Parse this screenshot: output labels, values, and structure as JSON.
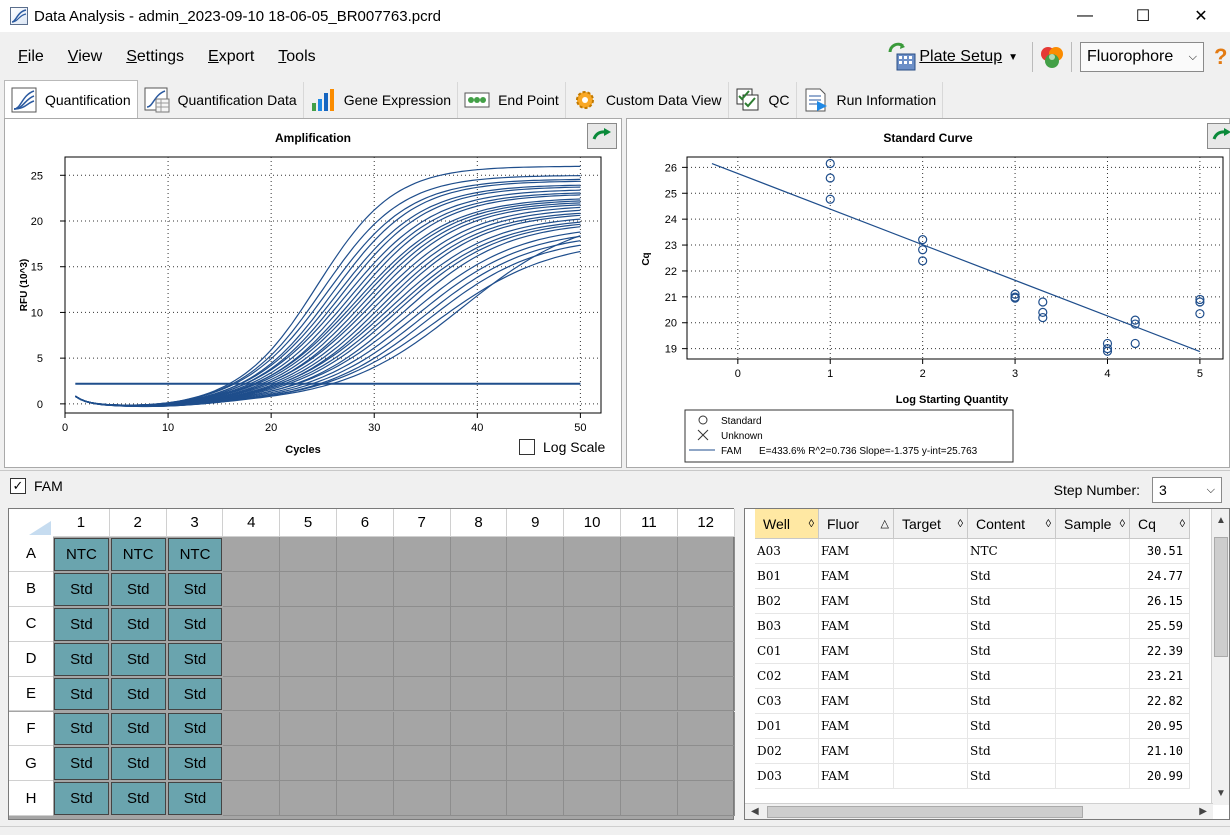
{
  "window": {
    "title": "Data Analysis - admin_2023-09-10 18-06-05_BR007763.pcrd",
    "minimize": "—",
    "maximize": "☐",
    "close": "✕"
  },
  "menu": {
    "items": [
      {
        "first": "F",
        "rest": "ile"
      },
      {
        "first": "V",
        "rest": "iew"
      },
      {
        "first": "S",
        "rest": "ettings"
      },
      {
        "first": "E",
        "rest": "xport"
      },
      {
        "first": "T",
        "rest": "ools"
      }
    ],
    "plate_setup": "Plate Setup",
    "fluorophore": "Fluorophore",
    "help": "?"
  },
  "tabs": [
    {
      "label": "Quantification",
      "icon": "amplification-icon",
      "active": true
    },
    {
      "label": "Quantification Data",
      "icon": "quant-data-icon"
    },
    {
      "label": "Gene Expression",
      "icon": "bar-chart-icon"
    },
    {
      "label": "End Point",
      "icon": "end-point-icon"
    },
    {
      "label": "Custom Data View",
      "icon": "gear-icon"
    },
    {
      "label": "QC",
      "icon": "qc-icon"
    },
    {
      "label": "Run Information",
      "icon": "run-info-icon"
    }
  ],
  "amplification": {
    "title": "Amplification",
    "xlabel": "Cycles",
    "ylabel": "RFU (10^3)",
    "log_scale_label": "Log Scale",
    "log_scale_checked": false
  },
  "standard_curve": {
    "title": "Standard Curve",
    "xlabel": "Log Starting Quantity",
    "ylabel": "Cq",
    "legend_standard": "Standard",
    "legend_unknown": "Unknown",
    "legend_fam": "FAM",
    "legend_stats": "E=433.6% R^2=0.736 Slope=-1.375 y-int=25.763"
  },
  "chart_data": [
    {
      "type": "line",
      "title": "Amplification",
      "xlabel": "Cycles",
      "ylabel": "RFU (10^3)",
      "xlim": [
        0,
        52
      ],
      "ylim": [
        -1,
        27
      ],
      "xticks": [
        0,
        10,
        20,
        30,
        40,
        50
      ],
      "yticks": [
        0,
        5,
        10,
        15,
        20,
        25
      ],
      "grid": true,
      "threshold": 2.2,
      "curve_model": {
        "baseline_min": -0.4,
        "curves": 27
      },
      "series": [
        {
          "midpoint": 24.5,
          "plateau": 26.0,
          "slope": 0.27
        },
        {
          "midpoint": 25.0,
          "plateau": 25.0,
          "slope": 0.26
        },
        {
          "midpoint": 25.5,
          "plateau": 24.6,
          "slope": 0.25
        },
        {
          "midpoint": 26.0,
          "plateau": 24.4,
          "slope": 0.25
        },
        {
          "midpoint": 26.4,
          "plateau": 24.0,
          "slope": 0.24
        },
        {
          "midpoint": 26.8,
          "plateau": 23.8,
          "slope": 0.24
        },
        {
          "midpoint": 27.2,
          "plateau": 23.5,
          "slope": 0.23
        },
        {
          "midpoint": 27.6,
          "plateau": 23.2,
          "slope": 0.23
        },
        {
          "midpoint": 28.0,
          "plateau": 23.0,
          "slope": 0.23
        },
        {
          "midpoint": 28.3,
          "plateau": 22.6,
          "slope": 0.22
        },
        {
          "midpoint": 28.6,
          "plateau": 22.4,
          "slope": 0.22
        },
        {
          "midpoint": 29.0,
          "plateau": 22.2,
          "slope": 0.22
        },
        {
          "midpoint": 29.4,
          "plateau": 22.0,
          "slope": 0.22
        },
        {
          "midpoint": 29.8,
          "plateau": 21.8,
          "slope": 0.21
        },
        {
          "midpoint": 30.2,
          "plateau": 21.5,
          "slope": 0.21
        },
        {
          "midpoint": 30.6,
          "plateau": 21.2,
          "slope": 0.21
        },
        {
          "midpoint": 31.0,
          "plateau": 21.0,
          "slope": 0.21
        },
        {
          "midpoint": 31.4,
          "plateau": 20.7,
          "slope": 0.2
        },
        {
          "midpoint": 31.8,
          "plateau": 20.4,
          "slope": 0.2
        },
        {
          "midpoint": 32.2,
          "plateau": 20.2,
          "slope": 0.2
        },
        {
          "midpoint": 32.8,
          "plateau": 20.0,
          "slope": 0.2
        },
        {
          "midpoint": 33.4,
          "plateau": 19.6,
          "slope": 0.19
        },
        {
          "midpoint": 34.0,
          "plateau": 19.2,
          "slope": 0.19
        },
        {
          "midpoint": 34.6,
          "plateau": 18.8,
          "slope": 0.19
        },
        {
          "midpoint": 35.2,
          "plateau": 18.4,
          "slope": 0.19
        },
        {
          "midpoint": 36.0,
          "plateau": 18.0,
          "slope": 0.18
        },
        {
          "midpoint": 38.5,
          "plateau": 21.0,
          "slope": 0.17
        }
      ]
    },
    {
      "type": "scatter",
      "title": "Standard Curve",
      "xlabel": "Log Starting Quantity",
      "ylabel": "Cq",
      "xlim": [
        -0.55,
        5.25
      ],
      "ylim": [
        18.6,
        26.4
      ],
      "xticks": [
        0,
        1,
        2,
        3,
        4,
        5
      ],
      "yticks": [
        19,
        20,
        21,
        22,
        23,
        24,
        25,
        26
      ],
      "grid": true,
      "points": [
        {
          "x": 1.0,
          "y": 26.15
        },
        {
          "x": 1.0,
          "y": 25.59
        },
        {
          "x": 1.0,
          "y": 24.77
        },
        {
          "x": 2.0,
          "y": 23.21
        },
        {
          "x": 2.0,
          "y": 22.82
        },
        {
          "x": 2.0,
          "y": 22.39
        },
        {
          "x": 3.0,
          "y": 21.1
        },
        {
          "x": 3.0,
          "y": 20.99
        },
        {
          "x": 3.0,
          "y": 20.95
        },
        {
          "x": 3.3,
          "y": 20.8
        },
        {
          "x": 3.3,
          "y": 20.4
        },
        {
          "x": 3.3,
          "y": 20.2
        },
        {
          "x": 4.0,
          "y": 19.2
        },
        {
          "x": 4.0,
          "y": 19.0
        },
        {
          "x": 4.0,
          "y": 18.9
        },
        {
          "x": 4.3,
          "y": 20.1
        },
        {
          "x": 4.3,
          "y": 19.95
        },
        {
          "x": 4.3,
          "y": 19.2
        },
        {
          "x": 5.0,
          "y": 20.9
        },
        {
          "x": 5.0,
          "y": 20.8
        },
        {
          "x": 5.0,
          "y": 20.35
        }
      ],
      "fit": {
        "slope": -1.375,
        "intercept": 25.763,
        "x_from": -0.28,
        "x_to": 5.0
      }
    }
  ],
  "fam": {
    "label": "FAM",
    "checked": true
  },
  "step": {
    "label": "Step Number:",
    "value": "3"
  },
  "plate": {
    "columns": [
      "1",
      "2",
      "3",
      "4",
      "5",
      "6",
      "7",
      "8",
      "9",
      "10",
      "11",
      "12"
    ],
    "rows": [
      "A",
      "B",
      "C",
      "D",
      "E",
      "F",
      "G",
      "H"
    ],
    "wells": [
      [
        "NTC",
        "NTC",
        "NTC"
      ],
      [
        "Std",
        "Std",
        "Std"
      ],
      [
        "Std",
        "Std",
        "Std"
      ],
      [
        "Std",
        "Std",
        "Std"
      ],
      [
        "Std",
        "Std",
        "Std"
      ],
      [
        "Std",
        "Std",
        "Std"
      ],
      [
        "Std",
        "Std",
        "Std"
      ],
      [
        "Std",
        "Std",
        "Std"
      ]
    ]
  },
  "table": {
    "headers": [
      {
        "label": "Well",
        "sort": "◊"
      },
      {
        "label": "Fluor",
        "sort": "△"
      },
      {
        "label": "Target",
        "sort": "◊"
      },
      {
        "label": "Content",
        "sort": "◊"
      },
      {
        "label": "Sample",
        "sort": "◊"
      },
      {
        "label": "Cq",
        "sort": "◊"
      }
    ],
    "rows": [
      [
        "A03",
        "FAM",
        "",
        "NTC",
        "",
        "30.51"
      ],
      [
        "B01",
        "FAM",
        "",
        "Std",
        "",
        "24.77"
      ],
      [
        "B02",
        "FAM",
        "",
        "Std",
        "",
        "26.15"
      ],
      [
        "B03",
        "FAM",
        "",
        "Std",
        "",
        "25.59"
      ],
      [
        "C01",
        "FAM",
        "",
        "Std",
        "",
        "22.39"
      ],
      [
        "C02",
        "FAM",
        "",
        "Std",
        "",
        "23.21"
      ],
      [
        "C03",
        "FAM",
        "",
        "Std",
        "",
        "22.82"
      ],
      [
        "D01",
        "FAM",
        "",
        "Std",
        "",
        "20.95"
      ],
      [
        "D02",
        "FAM",
        "",
        "Std",
        "",
        "21.10"
      ],
      [
        "D03",
        "FAM",
        "",
        "Std",
        "",
        "20.99"
      ]
    ]
  }
}
